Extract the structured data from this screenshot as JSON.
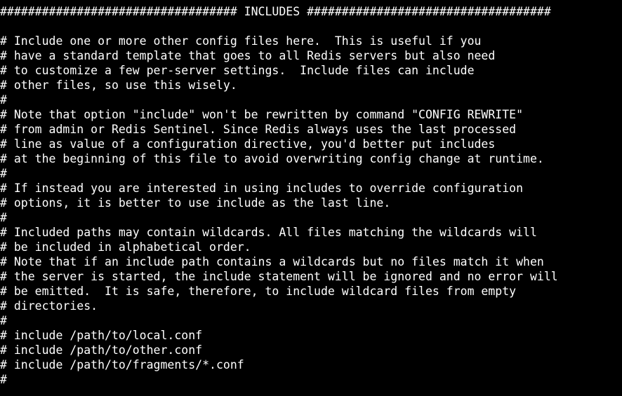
{
  "terminal": {
    "lines": [
      "################################## INCLUDES ###################################",
      "",
      "# Include one or more other config files here.  This is useful if you",
      "# have a standard template that goes to all Redis servers but also need",
      "# to customize a few per-server settings.  Include files can include",
      "# other files, so use this wisely.",
      "#",
      "# Note that option \"include\" won't be rewritten by command \"CONFIG REWRITE\"",
      "# from admin or Redis Sentinel. Since Redis always uses the last processed",
      "# line as value of a configuration directive, you'd better put includes",
      "# at the beginning of this file to avoid overwriting config change at runtime.",
      "#",
      "# If instead you are interested in using includes to override configuration",
      "# options, it is better to use include as the last line.",
      "#",
      "# Included paths may contain wildcards. All files matching the wildcards will",
      "# be included in alphabetical order.",
      "# Note that if an include path contains a wildcards but no files match it when",
      "# the server is started, the include statement will be ignored and no error will",
      "# be emitted.  It is safe, therefore, to include wildcard files from empty",
      "# directories.",
      "#",
      "# include /path/to/local.conf",
      "# include /path/to/other.conf",
      "# include /path/to/fragments/*.conf",
      "#"
    ]
  }
}
